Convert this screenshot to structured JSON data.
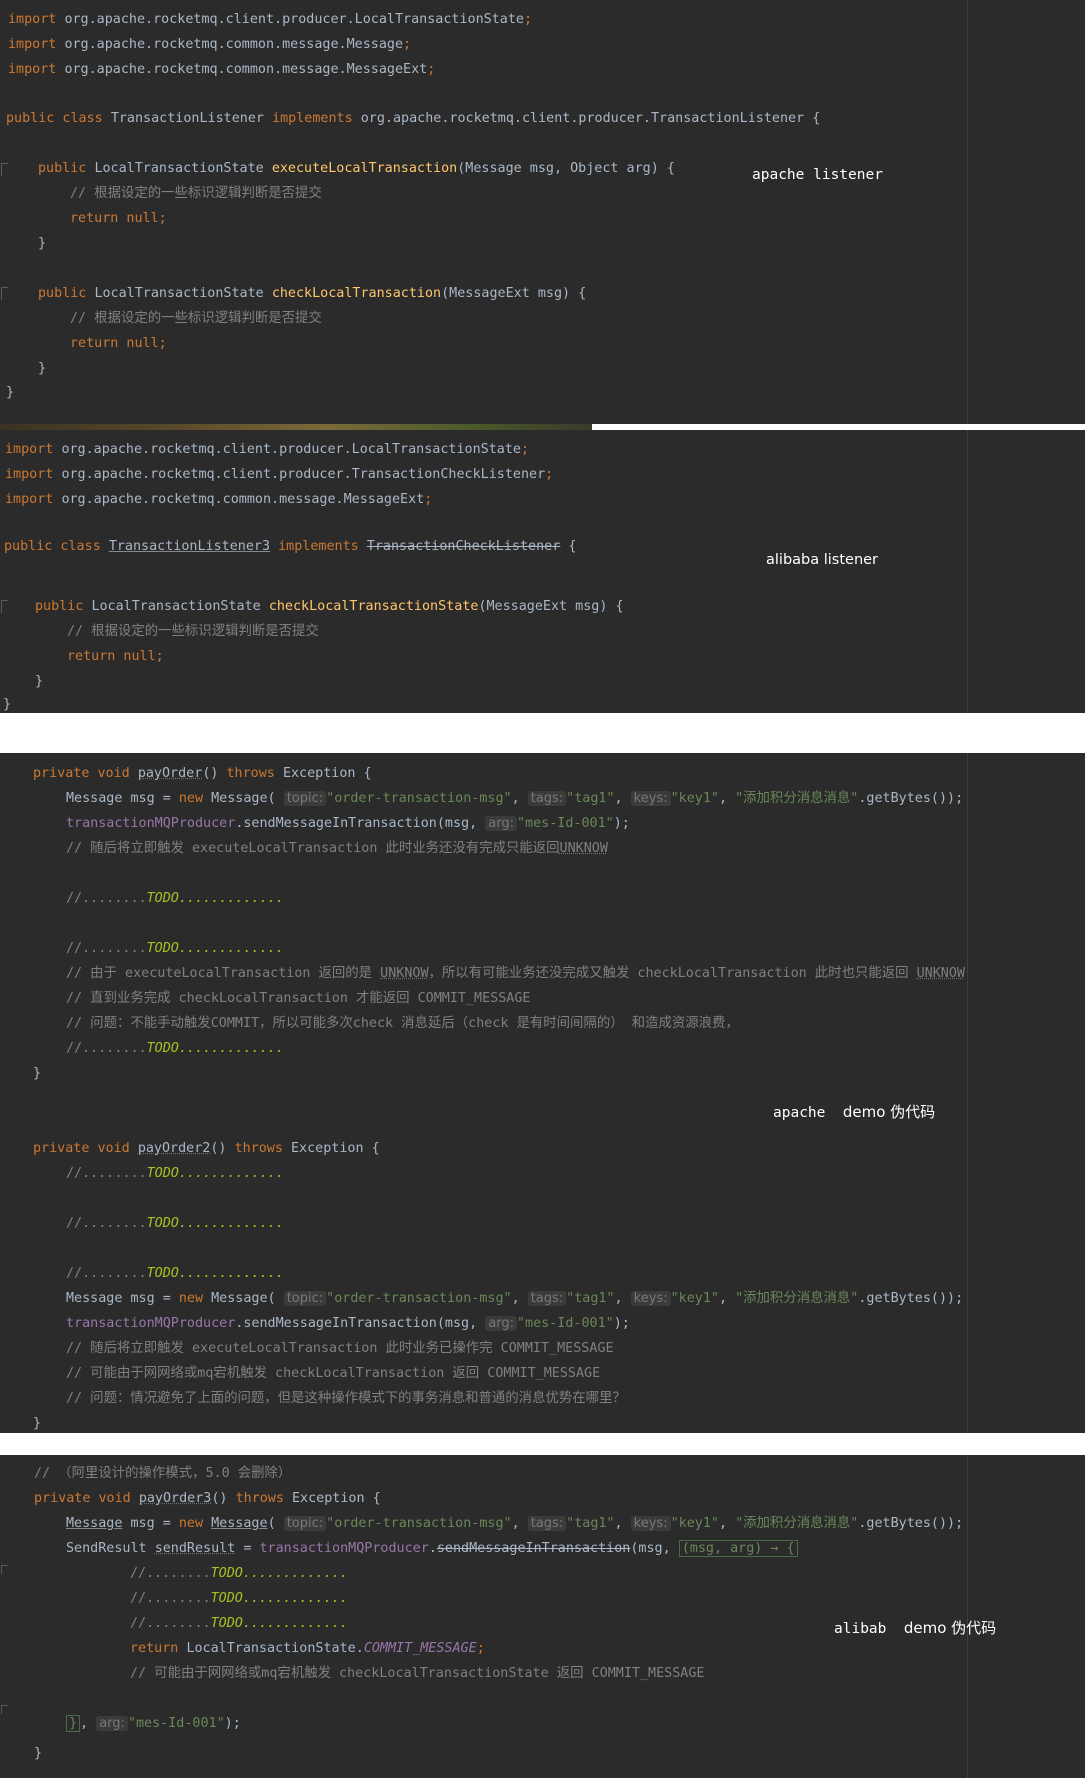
{
  "panel1": {
    "note": "apache listener",
    "imports": [
      "org.apache.rocketmq.client.producer.LocalTransactionState",
      "org.apache.rocketmq.common.message.Message",
      "org.apache.rocketmq.common.message.MessageExt"
    ],
    "class_name": "TransactionListener",
    "implements_target": "org.apache.rocketmq.client.producer.TransactionListener",
    "method1": {
      "name": "executeLocalTransaction",
      "params": "(Message msg, Object arg) {"
    },
    "method2": {
      "name": "checkLocalTransaction",
      "params": "(MessageExt msg) {"
    },
    "comment": "// 根据设定的一些标识逻辑判断是否提交",
    "return_stmt": "return null;"
  },
  "panel2": {
    "note": "alibaba listener",
    "imports": [
      "org.apache.rocketmq.client.producer.LocalTransactionState",
      "org.apache.rocketmq.client.producer.TransactionCheckListener",
      "org.apache.rocketmq.common.message.MessageExt"
    ],
    "class_name": "TransactionListener3",
    "implements_target": "TransactionCheckListener",
    "method": {
      "name": "checkLocalTransactionState",
      "params": "(MessageExt msg) {"
    },
    "comment": "// 根据设定的一些标识逻辑判断是否提交",
    "return_stmt": "return null;"
  },
  "panel3": {
    "note_mono": "apache",
    "note_cn": "demo 伪代码",
    "method_a": "payOrder",
    "method_b": "payOrder2",
    "todo_prefix": "//........",
    "todo_word": "TODO",
    "todo_suffix": ".............",
    "msg_topic_hint": "topic:",
    "msg_topic": "\"order-transaction-msg\"",
    "msg_tags_hint": "tags:",
    "msg_tags": "\"tag1\"",
    "msg_keys_hint": "keys:",
    "msg_keys": "\"key1\"",
    "msg_body": "\"添加积分消息消息\"",
    "arg_hint": "arg:",
    "arg_value": "\"mes-Id-001\"",
    "c_a1_pre": "// 随后将立即触发 executeLocalTransaction 此时业务还没有完成只能返回",
    "c_a1_unk": "UNKNOW",
    "c_a2_pre": "// 由于 executeLocalTransaction 返回的是 ",
    "c_a2_mid": "，所以有可能业务还没完成又触发 checkLocalTransaction 此时也只能返回 ",
    "c_a3": "// 直到业务完成 checkLocalTransaction 才能返回 COMMIT_MESSAGE",
    "c_a4": "// 问题：不能手动触发COMMIT，所以可能多次check 消息延后（check 是有时间间隔的） 和造成资源浪费，",
    "c_b1": "// 随后将立即触发 executeLocalTransaction 此时业务已操作完 COMMIT_MESSAGE",
    "c_b2": "// 可能由于网网络或mq宕机触发 checkLocalTransaction 返回 COMMIT_MESSAGE",
    "c_b3": "// 问题：情况避免了上面的问题，但是这种操作模式下的事务消息和普通的消息优势在哪里？"
  },
  "panel4": {
    "note_mono": "alibab",
    "note_cn": "demo 伪代码",
    "header_comment": "// （阿里设计的操作模式，5.0 会删除）",
    "method": "payOrder3",
    "send_var": "sendResult",
    "send_method": "sendMessageInTransaction",
    "lambda": "(msg, arg) → {",
    "return_const": "COMMIT_MESSAGE",
    "comment": "// 可能由于网网络或mq宕机触发 checkLocalTransactionState 返回 COMMIT_MESSAGE"
  }
}
